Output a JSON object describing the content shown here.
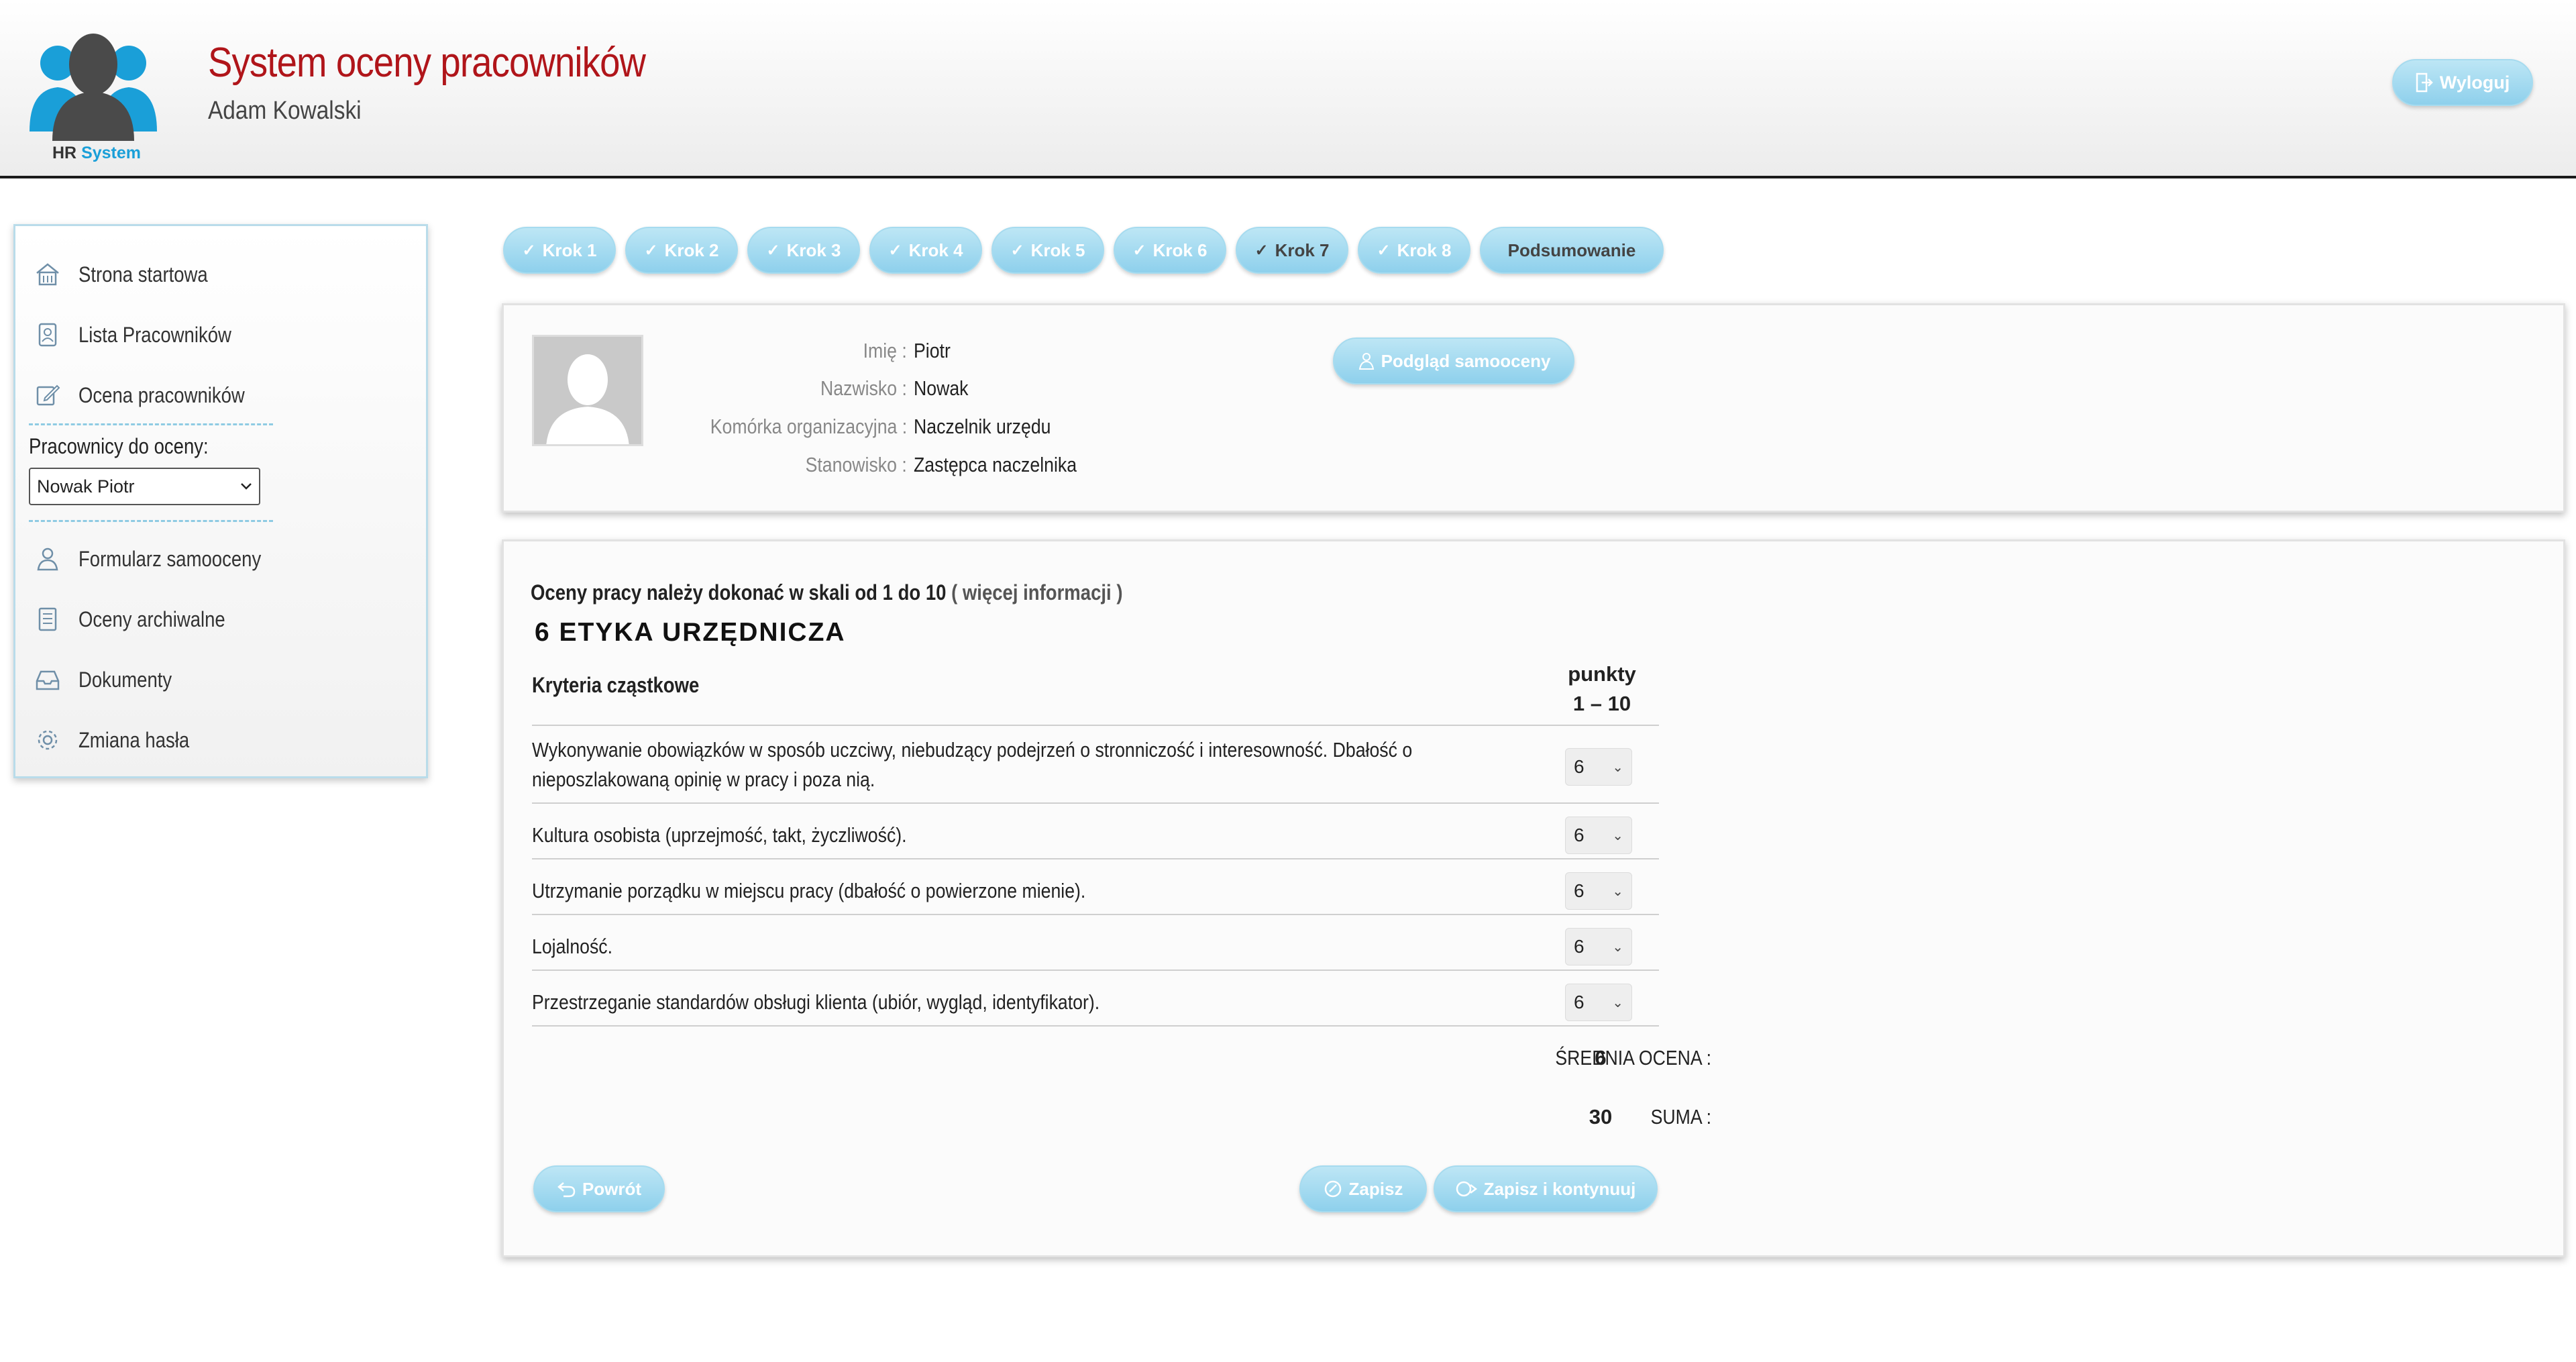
{
  "header": {
    "logo_line1": "HR",
    "logo_line2": "System",
    "title": "System oceny pracowników",
    "user": "Adam Kowalski",
    "logout_label": "Wyloguj"
  },
  "sidebar": {
    "items": [
      {
        "label": "Strona startowa",
        "icon": "home-icon"
      },
      {
        "label": "Lista Pracowników",
        "icon": "people-list-icon"
      },
      {
        "label": "Ocena pracowników",
        "icon": "edit-icon"
      }
    ],
    "employees_label": "Pracownicy do oceny:",
    "employee_selected": "Nowak Piotr",
    "items_bottom": [
      {
        "label": "Formularz samooceny",
        "icon": "person-icon"
      },
      {
        "label": "Oceny archiwalne",
        "icon": "archive-icon"
      },
      {
        "label": "Dokumenty",
        "icon": "inbox-icon"
      },
      {
        "label": "Zmiana hasła",
        "icon": "gear-icon"
      }
    ]
  },
  "steps": [
    {
      "label": "Krok 1"
    },
    {
      "label": "Krok 2"
    },
    {
      "label": "Krok 3"
    },
    {
      "label": "Krok 4"
    },
    {
      "label": "Krok 5"
    },
    {
      "label": "Krok 6"
    },
    {
      "label": "Krok 7"
    },
    {
      "label": "Krok 8"
    },
    {
      "label": "Podsumowanie"
    }
  ],
  "employee": {
    "rows": [
      {
        "label": "Imię :",
        "value": "Piotr"
      },
      {
        "label": "Nazwisko :",
        "value": "Nowak"
      },
      {
        "label": "Komórka organizacyjna :",
        "value": "Naczelnik urzędu"
      },
      {
        "label": "Stanowisko :",
        "value": "Zastępca naczelnika"
      }
    ],
    "preview_label": "Podgląd samooceny"
  },
  "evaluation": {
    "scale_note": "Oceny pracy należy dokonać w skali od 1 do 10",
    "more_info": "( więcej informacji )",
    "section_title": "6 ETYKA URZĘDNICZA",
    "col_criteria": "Kryteria cząstkowe",
    "col_points_1": "punkty",
    "col_points_2": "1 – 10",
    "criteria": [
      {
        "text": "Wykonywanie obowiązków w sposób uczciwy, niebudzący podejrzeń o stronniczość i interesowność. Dbałość o nieposzlakowaną opinię w pracy i poza nią.",
        "score": "6"
      },
      {
        "text": "Kultura osobista (uprzejmość, takt, życzliwość).",
        "score": "6"
      },
      {
        "text": "Utrzymanie porządku w miejscu pracy (dbałość o powierzone mienie).",
        "score": "6"
      },
      {
        "text": "Lojalność.",
        "score": "6"
      },
      {
        "text": "Przestrzeganie standardów obsługi klienta (ubiór, wygląd, identyfikator).",
        "score": "6"
      }
    ],
    "avg_label": "ŚREDNIA OCENA :",
    "avg_value": "6",
    "sum_label": "SUMA :",
    "sum_value": "30",
    "back_label": "Powrót",
    "save_label": "Zapisz",
    "save_continue_label": "Zapisz i kontynuuj"
  },
  "colors": {
    "title_red": "#b0151a",
    "button_blue": "#8ed0ec",
    "logo_blue": "#1a9fd8"
  }
}
